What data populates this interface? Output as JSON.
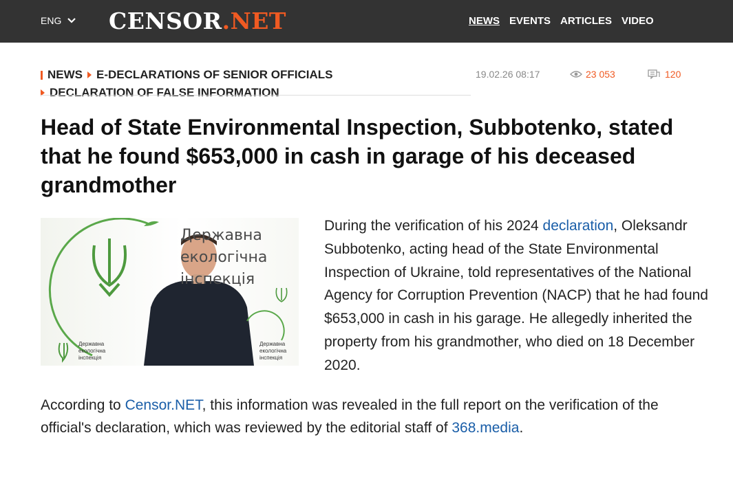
{
  "header": {
    "lang": "ENG",
    "logo_part1": "CENSOR",
    "logo_part2": ".NET",
    "nav": [
      "NEWS",
      "EVENTS",
      "ARTICLES",
      "VIDEO"
    ],
    "colors": {
      "bar": "#333333",
      "accent": "#f05a22",
      "link": "#1a5ea8"
    }
  },
  "breadcrumbs": {
    "item1": "NEWS",
    "item2": "E-DECLARATIONS OF SENIOR OFFICIALS",
    "item3": "DECLARATION OF FALSE INFORMATION"
  },
  "meta": {
    "datetime": "19.02.26 08:17",
    "views": "23 053",
    "comments": "120"
  },
  "article": {
    "title": "Head of State Environmental Inspection, Subbotenko, stated that he found $653,000 in cash in garage of his deceased grandmother",
    "photo_text": [
      "Державна",
      "екологічна",
      "інспекція"
    ],
    "photo_small_text": [
      "Державна",
      "екологічна",
      "інспекція"
    ],
    "p1_before": "During the verification of his 2024 ",
    "p1_link": "declaration",
    "p1_after": ", Oleksandr Subbotenko, acting head of the State Environmental Inspection of Ukraine, told representatives of the National Agency for Corruption Prevention (NACP) that he had found $653,000 in cash in his garage. He allegedly inherited the property from his grandmother, who died on 18 December 2020.",
    "p2_before": "According to ",
    "p2_link1": "Censor.NET",
    "p2_middle": ", this information was revealed in the full report on the verification of the official's declaration, which was reviewed by the editorial staff of ",
    "p2_link2": "368.media",
    "p2_end": "."
  }
}
